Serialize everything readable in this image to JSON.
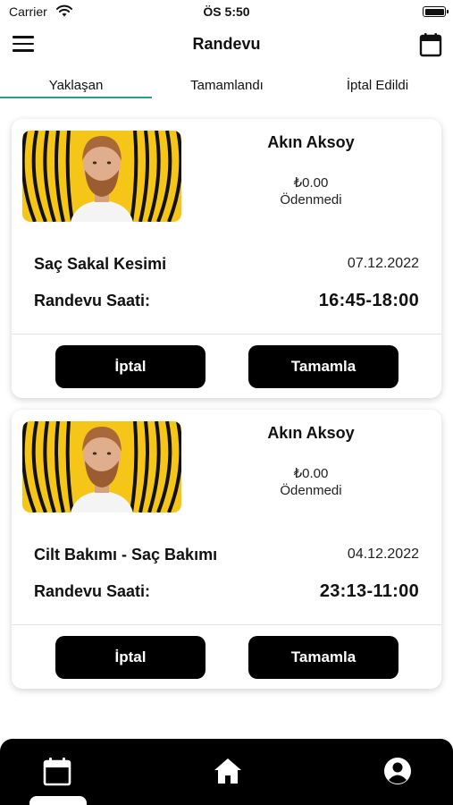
{
  "status_bar": {
    "carrier": "Carrier",
    "time": "ÖS 5:50"
  },
  "header": {
    "title": "Randevu"
  },
  "tabs": [
    {
      "label": "Yaklaşan",
      "active": true
    },
    {
      "label": "Tamamlandı",
      "active": false
    },
    {
      "label": "İptal Edildi",
      "active": false
    }
  ],
  "appointments": [
    {
      "name": "Akın Aksoy",
      "price": "₺0.00",
      "payment_status": "Ödenmedi",
      "service": "Saç Sakal Kesimi",
      "date": "07.12.2022",
      "time_label": "Randevu Saati:",
      "time": "16:45-18:00",
      "cancel_label": "İptal",
      "complete_label": "Tamamla"
    },
    {
      "name": "Akın Aksoy",
      "price": "₺0.00",
      "payment_status": "Ödenmedi",
      "service": "Cilt Bakımı - Saç Bakımı",
      "date": "04.12.2022",
      "time_label": "Randevu Saati:",
      "time": "23:13-11:00",
      "cancel_label": "İptal",
      "complete_label": "Tamamla"
    }
  ],
  "colors": {
    "accent": "#2a9d8f",
    "avatar_bg": "#f5c518",
    "button_bg": "#000000"
  },
  "icons": {
    "menu": "menu-icon",
    "calendar": "calendar-icon",
    "home": "home-icon",
    "profile": "profile-icon"
  }
}
